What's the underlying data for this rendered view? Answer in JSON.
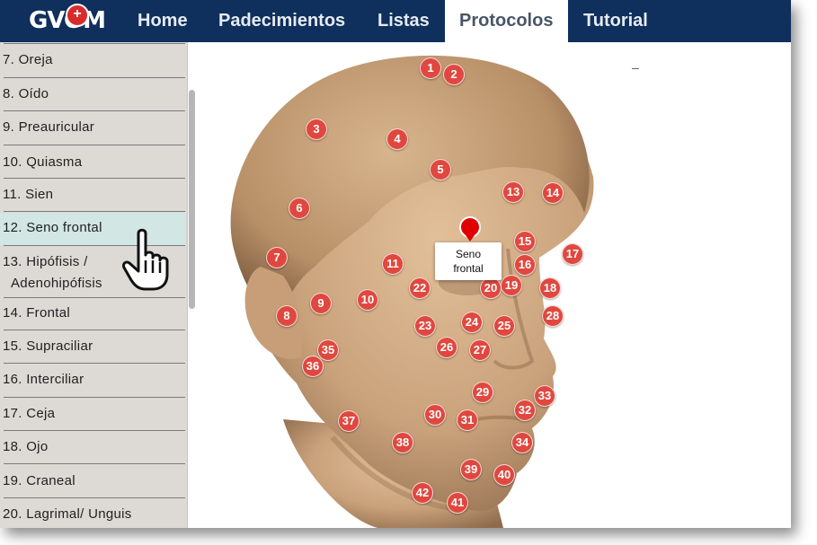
{
  "logo": {
    "text": "GVOM",
    "badge": "+"
  },
  "nav": [
    {
      "label": "Home",
      "active": false
    },
    {
      "label": "Padecimientos",
      "active": false
    },
    {
      "label": "Listas",
      "active": false
    },
    {
      "label": "Protocolos",
      "active": true
    },
    {
      "label": "Tutorial",
      "active": false
    }
  ],
  "sidebar": {
    "items": [
      "7. Oreja",
      "8. Oído",
      "9. Preauricular",
      "10. Quiasma",
      "11. Sien",
      "12. Seno frontal",
      "13. Hipófisis /",
      "Adenohipófisis",
      "14. Frontal",
      "15. Supraciliar",
      "16. Interciliar",
      "17. Ceja",
      "18. Ojo",
      "19. Craneal",
      "20. Lagrimal/ Unguis"
    ],
    "selected": "12. Seno frontal"
  },
  "tooltip": {
    "line1": "Seno",
    "line2": "frontal"
  },
  "markers": [
    "1",
    "2",
    "3",
    "4",
    "5",
    "6",
    "7",
    "8",
    "9",
    "10",
    "11",
    "13",
    "14",
    "15",
    "16",
    "17",
    "18",
    "19",
    "20",
    "22",
    "23",
    "24",
    "25",
    "26",
    "27",
    "28",
    "29",
    "30",
    "31",
    "32",
    "33",
    "34",
    "35",
    "36",
    "37",
    "38",
    "39",
    "40",
    "41",
    "42"
  ],
  "colors": {
    "nav_bg": "#0f2f5c",
    "marker": "#e0483f",
    "pin": "#e00000",
    "sidebar_bg": "#dddad6",
    "highlight": "#d2e6e4"
  }
}
